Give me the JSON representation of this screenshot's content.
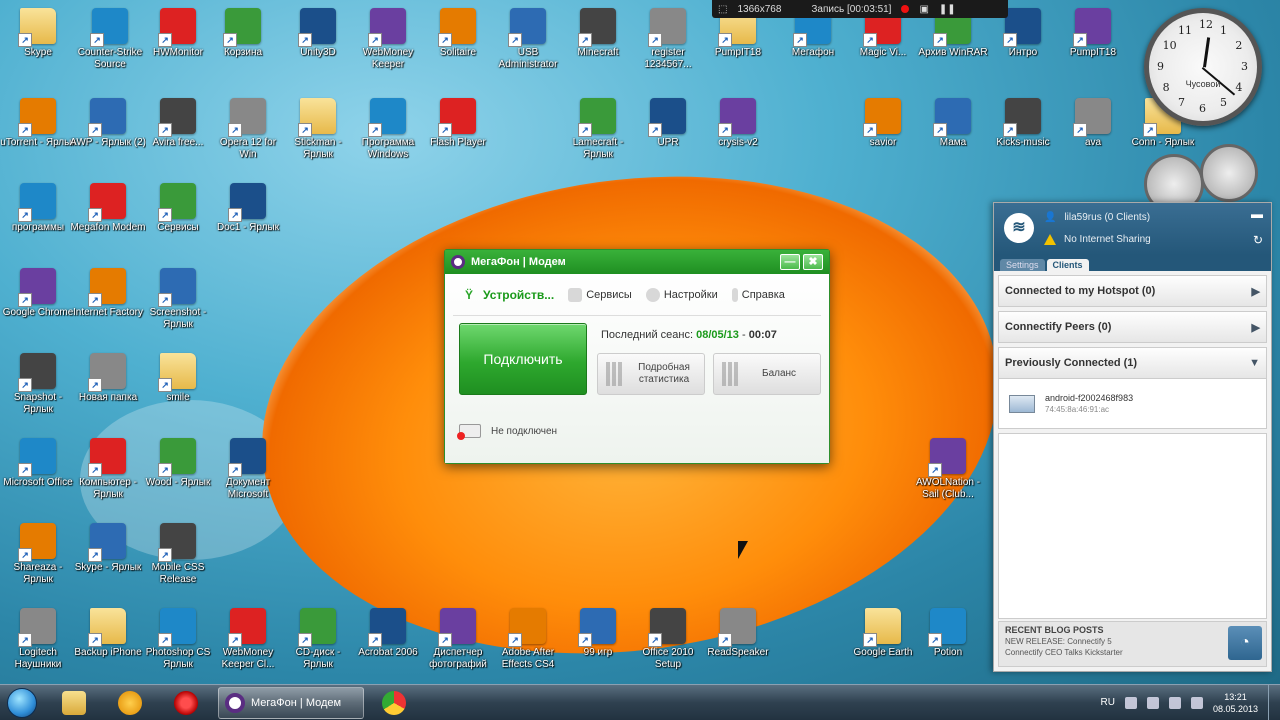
{
  "desktop": {
    "icons": [
      {
        "label": "Skype"
      },
      {
        "label": "Counter-Strike Source"
      },
      {
        "label": "HWMonitor"
      },
      {
        "label": "Корзина"
      },
      {
        "label": "Unity3D"
      },
      {
        "label": "WebMoney Keeper"
      },
      {
        "label": "Solitaire"
      },
      {
        "label": "USB Administrator"
      },
      {
        "label": "Minecraft"
      },
      {
        "label": "register 1234567..."
      },
      {
        "label": "PumpIT18"
      },
      {
        "label": "Мегафон"
      },
      {
        "label": "Magic Vi..."
      },
      {
        "label": "Архив WinRAR"
      },
      {
        "label": "Интро"
      },
      {
        "label": "PumpIT18"
      },
      {
        "label": "uTorrent - Ярлык"
      },
      {
        "label": "AWP - Ярлык (2)"
      },
      {
        "label": "Avira free..."
      },
      {
        "label": "Opera 12 for Win"
      },
      {
        "label": "Stickman - Ярлык"
      },
      {
        "label": "Программа Windows"
      },
      {
        "label": "Flash Player"
      },
      {
        "label": "Lamecraft - Ярлык"
      },
      {
        "label": "UPR"
      },
      {
        "label": "crysis-v2"
      },
      {
        "label": "savior"
      },
      {
        "label": "Мама"
      },
      {
        "label": "Kicks-music"
      },
      {
        "label": "ava"
      },
      {
        "label": "Conn - Ярлык"
      },
      {
        "label": "программы"
      },
      {
        "label": "Megafon Modem"
      },
      {
        "label": "Сервисы"
      },
      {
        "label": "Doc1 - Ярлык"
      },
      {
        "label": "Google Chrome"
      },
      {
        "label": "Internet Factory"
      },
      {
        "label": "Screenshot - Ярлык"
      },
      {
        "label": "Snapshot - Ярлык"
      },
      {
        "label": "Новая папка"
      },
      {
        "label": "smile"
      },
      {
        "label": "Microsoft Office"
      },
      {
        "label": "Компьютер - Ярлык"
      },
      {
        "label": "Wood - Ярлык"
      },
      {
        "label": "Документ Microsoft"
      },
      {
        "label": "AWOLNation - Sail (Club..."
      },
      {
        "label": "Shareaza - Ярлык"
      },
      {
        "label": "Skype - Ярлык"
      },
      {
        "label": "Mobile CSS Release"
      },
      {
        "label": "Logitech Наушники"
      },
      {
        "label": "Backup iPhone"
      },
      {
        "label": "Photoshop CS Ярлык"
      },
      {
        "label": "WebMoney Keeper Cl..."
      },
      {
        "label": "CD-диск - Ярлык"
      },
      {
        "label": "Acrobat 2006"
      },
      {
        "label": "Диспетчер фотографий"
      },
      {
        "label": "Adobe After Effects CS4"
      },
      {
        "label": "99 игр"
      },
      {
        "label": "Office 2010 Setup"
      },
      {
        "label": "ReadSpeaker"
      },
      {
        "label": "Google Earth"
      },
      {
        "label": "Potion"
      }
    ]
  },
  "recorder": {
    "resolution": "1366x768",
    "status": "Запись [00:03:51]"
  },
  "clock_gadget": {
    "city": "Чусовой",
    "numerals": [
      "12",
      "1",
      "2",
      "3",
      "4",
      "5",
      "6",
      "7",
      "8",
      "9",
      "10",
      "11"
    ]
  },
  "megafon": {
    "title": "МегаФон | Модем",
    "tabs": [
      {
        "label": "Устройств...",
        "active": true
      },
      {
        "label": "Сервисы"
      },
      {
        "label": "Настройки"
      },
      {
        "label": "Справка"
      }
    ],
    "connect_label": "Подключить",
    "session_label": "Последний сеанс:",
    "session_date": "08/05/13",
    "session_sep": "-",
    "session_time": "00:07",
    "stats_label": "Подробная статистика",
    "balance_label": "Баланс",
    "status_label": "Не подключен",
    "minimize": "—",
    "close": "✖"
  },
  "connectify": {
    "hotspot_line": "lila59rus (0 Clients)",
    "sharing_line": "No Internet Sharing",
    "tabs": [
      {
        "label": "Settings"
      },
      {
        "label": "Clients",
        "active": true
      }
    ],
    "sections": [
      {
        "label": "Connected to my Hotspot (0)",
        "arrow": "▶"
      },
      {
        "label": "Connectify Peers (0)",
        "arrow": "▶"
      },
      {
        "label": "Previously Connected (1)",
        "arrow": "▼"
      }
    ],
    "client_name": "android-f2002468f983",
    "client_mac": "74:45:8a:46:91:ac",
    "blog_heading": "RECENT BLOG POSTS",
    "blog_post_1": "NEW RELEASE: Connectify 5",
    "blog_post_2": "Connectify CEO Talks Kickstarter"
  },
  "taskbar": {
    "active_task": "МегаФон | Модем",
    "language": "RU",
    "time": "13:21",
    "date": "08.05.2013"
  },
  "colors": {
    "megafon_green": "#1f8f21",
    "connectify_blue": "#245779",
    "taskbar": "#2f4150"
  }
}
